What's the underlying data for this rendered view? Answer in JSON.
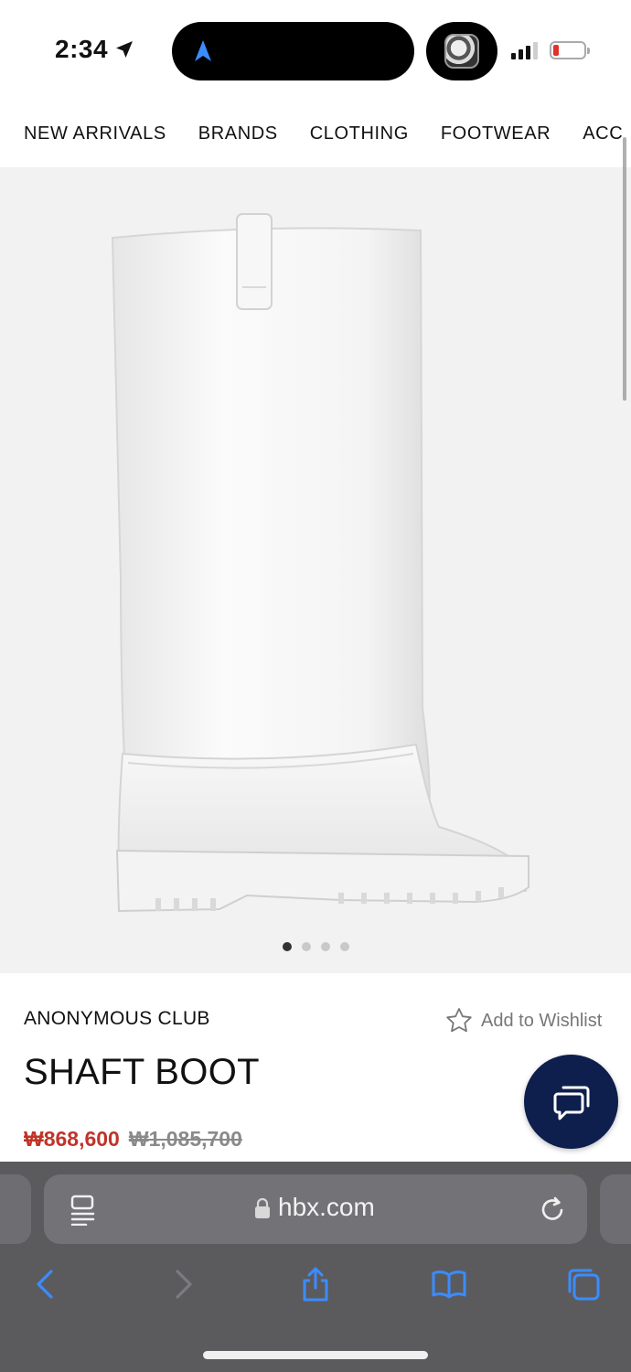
{
  "status_bar": {
    "time": "2:34",
    "battery_color": "#e2302a"
  },
  "category_nav": {
    "items": [
      "NEW ARRIVALS",
      "BRANDS",
      "CLOTHING",
      "FOOTWEAR",
      "ACC"
    ]
  },
  "carousel": {
    "total_slides": 4,
    "active_index": 0
  },
  "product": {
    "brand": "ANONYMOUS CLUB",
    "name": "SHAFT BOOT",
    "price_sale": "₩868,600",
    "price_original": "₩1,085,700",
    "wishlist_label": "Add to Wishlist",
    "sale_color": "#c0342a"
  },
  "chat": {
    "icon": "chat-bubbles-icon",
    "color": "#0e1f4d"
  },
  "browser": {
    "url": "hbx.com",
    "icons": [
      "reader-icon",
      "lock-icon",
      "reload-icon",
      "back-icon",
      "forward-icon",
      "share-icon",
      "bookmarks-icon",
      "tabs-icon"
    ],
    "accent": "#3b82f6"
  }
}
